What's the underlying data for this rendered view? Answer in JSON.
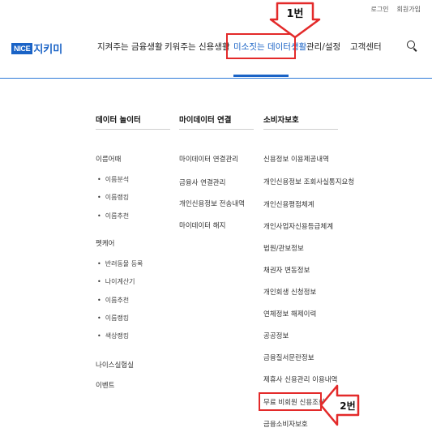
{
  "util": {
    "login": "로그인",
    "signup": "회원가입"
  },
  "logo": {
    "nice": "NICE",
    "name": "지키미"
  },
  "gnb": [
    {
      "label": "지켜주는 금융생활"
    },
    {
      "label": "키워주는 신용생활"
    },
    {
      "label": "미소짓는 데이터생활",
      "active": true
    },
    {
      "label": "관리/설정"
    },
    {
      "label": "고객센터"
    }
  ],
  "annotations": {
    "step1": "1번",
    "step2": "2번",
    "color": "#e32a2a"
  },
  "columns": [
    {
      "title": "데이터 놀이터",
      "groups": [
        {
          "label": "이름어때",
          "subs": [
            "이름분석",
            "이름랭킹",
            "이름추천"
          ]
        },
        {
          "label": "펫케어",
          "subs": [
            "반려동물 등록",
            "나이계산기",
            "이름추천",
            "이름랭킹",
            "색상랭킹"
          ]
        },
        {
          "label": "나이스실험실",
          "subs": []
        },
        {
          "label": "이벤트",
          "subs": []
        }
      ]
    },
    {
      "title": "마이데이터 연결",
      "items": [
        "마이데이터 연결관리",
        "금융사 연결관리",
        "개인신용정보 전송내역",
        "마이데이터 해지"
      ]
    },
    {
      "title": "소비자보호",
      "items": [
        "신용정보 이용제공내역",
        "개인신용정보 조회사실통지요청",
        "개인신용평점체계",
        "개인사업자신용등급체계",
        "법원/관보정보",
        "채권자 변동정보",
        "개인회생 신청정보",
        "연체정보 해제이력",
        "공공정보",
        "금융질서문란정보",
        "제휴사 신용관리 이용내역",
        "무료 비회원 신용조회",
        "금융소비자보호"
      ]
    }
  ],
  "colors": {
    "brand": "#1a63c6",
    "highlight": "#e32a2a"
  }
}
